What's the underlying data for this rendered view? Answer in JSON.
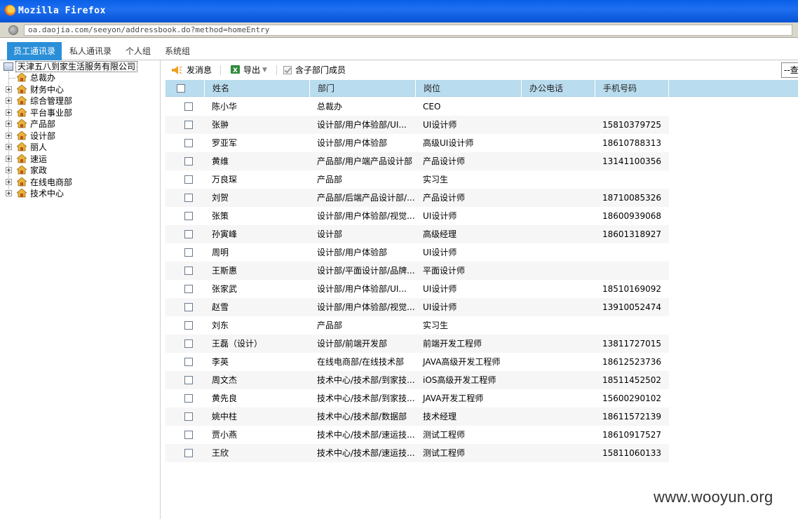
{
  "window": {
    "title": "Mozilla Firefox"
  },
  "address_bar": {
    "url": "oa.daojia.com/seeyon/addressbook.do?method=homeEntry"
  },
  "tabs": [
    {
      "label": "员工通讯录",
      "active": true
    },
    {
      "label": "私人通讯录",
      "active": false
    },
    {
      "label": "个人组",
      "active": false
    },
    {
      "label": "系统组",
      "active": false
    }
  ],
  "tree": {
    "root": "天津五八到家生活服务有限公司",
    "children": [
      {
        "label": "总裁办",
        "expandable": false
      },
      {
        "label": "财务中心",
        "expandable": true
      },
      {
        "label": "综合管理部",
        "expandable": true
      },
      {
        "label": "平台事业部",
        "expandable": true
      },
      {
        "label": "产品部",
        "expandable": true
      },
      {
        "label": "设计部",
        "expandable": true
      },
      {
        "label": "丽人",
        "expandable": true
      },
      {
        "label": "速运",
        "expandable": true
      },
      {
        "label": "家政",
        "expandable": true
      },
      {
        "label": "在线电商部",
        "expandable": true
      },
      {
        "label": "技术中心",
        "expandable": true
      }
    ]
  },
  "toolbar": {
    "send_message": "发消息",
    "export": "导出",
    "include_sub": "含子部门成员",
    "include_sub_checked": true,
    "query_select": "--查"
  },
  "grid": {
    "headers": [
      "姓名",
      "部门",
      "岗位",
      "办公电话",
      "手机号码"
    ],
    "rows": [
      {
        "name": "陈小华",
        "dept": "总裁办",
        "post": "CEO",
        "office": "",
        "mobile": ""
      },
      {
        "name": "张翀",
        "dept": "设计部/用户体验部/UI...",
        "post": "UI设计师",
        "office": "",
        "mobile": "15810379725"
      },
      {
        "name": "罗亚军",
        "dept": "设计部/用户体验部",
        "post": "高级UI设计师",
        "office": "",
        "mobile": "18610788313"
      },
      {
        "name": "黄维",
        "dept": "产品部/用户端产品设计部",
        "post": "产品设计师",
        "office": "",
        "mobile": "13141100356"
      },
      {
        "name": "万良琛",
        "dept": "产品部",
        "post": "实习生",
        "office": "",
        "mobile": ""
      },
      {
        "name": "刘贺",
        "dept": "产品部/后端产品设计部/...",
        "post": "产品设计师",
        "office": "",
        "mobile": "18710085326"
      },
      {
        "name": "张策",
        "dept": "设计部/用户体验部/视觉...",
        "post": "UI设计师",
        "office": "",
        "mobile": "18600939068"
      },
      {
        "name": "孙寅峰",
        "dept": "设计部",
        "post": "高级经理",
        "office": "",
        "mobile": "18601318927"
      },
      {
        "name": "周明",
        "dept": "设计部/用户体验部",
        "post": "UI设计师",
        "office": "",
        "mobile": ""
      },
      {
        "name": "王斯惠",
        "dept": "设计部/平面设计部/品牌...",
        "post": "平面设计师",
        "office": "",
        "mobile": ""
      },
      {
        "name": "张家武",
        "dept": "设计部/用户体验部/UI...",
        "post": "UI设计师",
        "office": "",
        "mobile": "18510169092"
      },
      {
        "name": "赵雪",
        "dept": "设计部/用户体验部/视觉...",
        "post": "UI设计师",
        "office": "",
        "mobile": "13910052474"
      },
      {
        "name": "刘东",
        "dept": "产品部",
        "post": "实习生",
        "office": "",
        "mobile": ""
      },
      {
        "name": "王磊（设计）",
        "dept": "设计部/前端开发部",
        "post": "前端开发工程师",
        "office": "",
        "mobile": "13811727015"
      },
      {
        "name": "李英",
        "dept": "在线电商部/在线技术部",
        "post": "JAVA高级开发工程师",
        "office": "",
        "mobile": "18612523736"
      },
      {
        "name": "周文杰",
        "dept": "技术中心/技术部/到家技...",
        "post": "iOS高级开发工程师",
        "office": "",
        "mobile": "18511452502"
      },
      {
        "name": "黄先良",
        "dept": "技术中心/技术部/到家技...",
        "post": "JAVA开发工程师",
        "office": "",
        "mobile": "15600290102"
      },
      {
        "name": "姚中柱",
        "dept": "技术中心/技术部/数据部",
        "post": "技术经理",
        "office": "",
        "mobile": "18611572139"
      },
      {
        "name": "贾小燕",
        "dept": "技术中心/技术部/速运技...",
        "post": "测试工程师",
        "office": "",
        "mobile": "18610917527"
      },
      {
        "name": "王欣",
        "dept": "技术中心/技术部/速运技...",
        "post": "测试工程师",
        "office": "",
        "mobile": "15811060133"
      }
    ]
  },
  "watermark": "www.wooyun.org",
  "colors": {
    "tab_active": "#2b8fd8",
    "grid_header": "#b9dcee",
    "titlebar": "#0a5fe8"
  }
}
